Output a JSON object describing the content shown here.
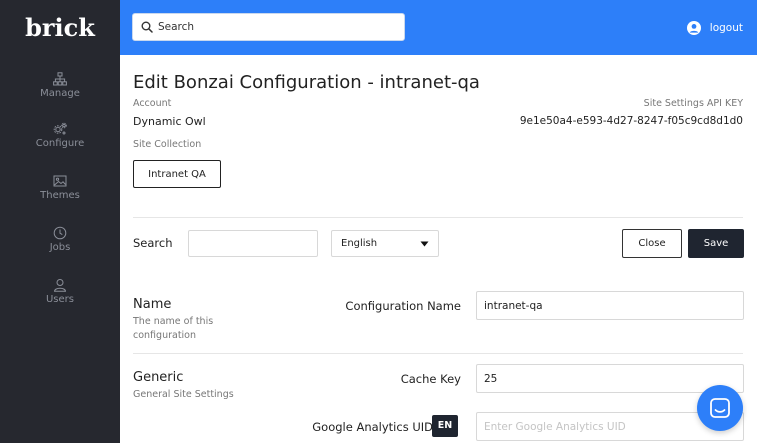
{
  "header": {
    "brand": "brick",
    "search_placeholder": "Search",
    "logout_label": "logout"
  },
  "sidebar": {
    "items": [
      {
        "label": "Manage",
        "icon": "sitemap-icon"
      },
      {
        "label": "Configure",
        "icon": "gears-icon"
      },
      {
        "label": "Themes",
        "icon": "image-icon"
      },
      {
        "label": "Jobs",
        "icon": "clock-icon"
      },
      {
        "label": "Users",
        "icon": "user-icon"
      }
    ]
  },
  "page": {
    "title": "Edit Bonzai Configuration - intranet-qa",
    "account_label": "Account",
    "account_value": "Dynamic Owl",
    "api_key_label": "Site Settings API KEY",
    "api_key_value": "9e1e50a4-e593-4d27-8247-f05c9cd8d1d0",
    "site_collection_label": "Site Collection",
    "site_collection_button": "Intranet QA"
  },
  "toolbar": {
    "search_label": "Search",
    "search_value": "",
    "language_selected": "English",
    "close_label": "Close",
    "save_label": "Save"
  },
  "sections": {
    "name": {
      "title": "Name",
      "description": "The name of this configuration",
      "field_label": "Configuration Name",
      "field_value": "intranet-qa"
    },
    "generic": {
      "title": "Generic",
      "description": "General Site Settings",
      "cache_key_label": "Cache Key",
      "cache_key_value": "25",
      "ga_label": "Google Analytics UID",
      "ga_lang_badge": "EN",
      "ga_placeholder": "Enter Google Analytics UID"
    }
  },
  "colors": {
    "topbar": "#2d7ff9",
    "sidebar": "#26282f",
    "save_button": "#1f2530"
  }
}
